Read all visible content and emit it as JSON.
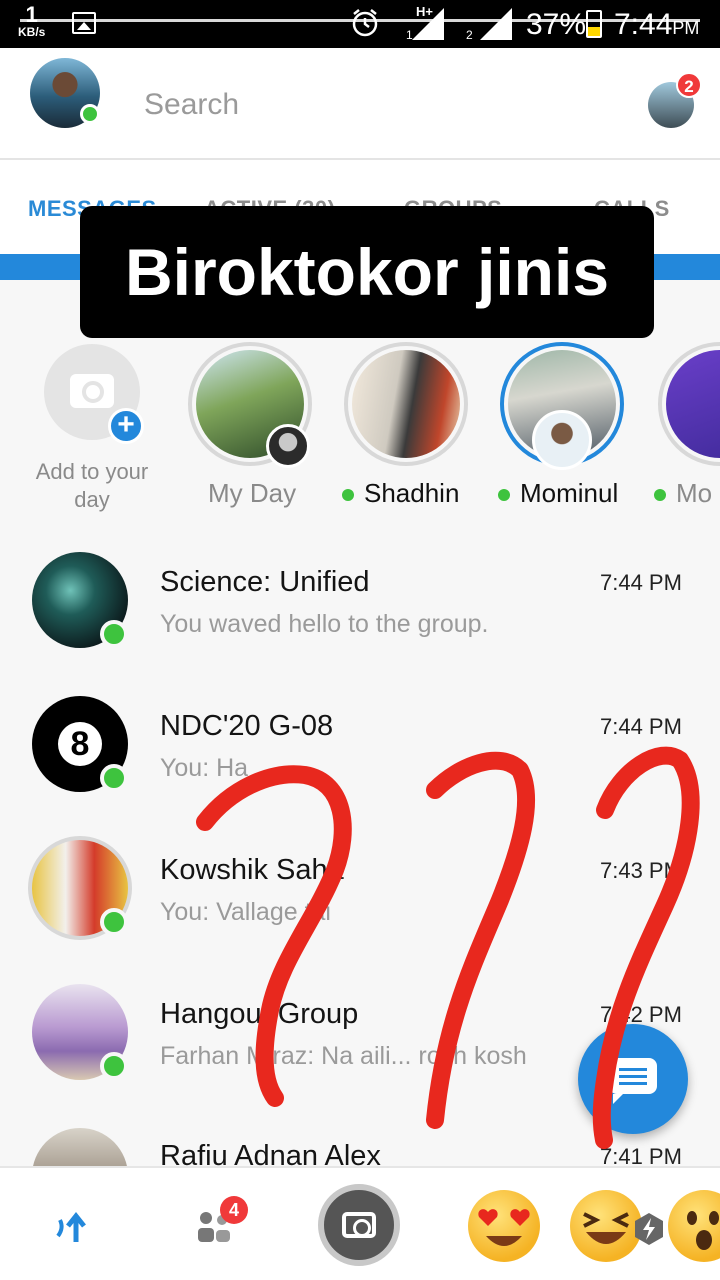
{
  "status_bar": {
    "net_speed": "1",
    "net_unit": "KB/s",
    "sim1": "1",
    "sim2": "2",
    "network_type": "H+",
    "battery": "37%",
    "time": "7:44",
    "time_suffix": "PM"
  },
  "header": {
    "search_placeholder": "Search",
    "people_badge": "2"
  },
  "tabs": [
    {
      "label": "MESSAGES",
      "active": true
    },
    {
      "label": "ACTIVE (30)",
      "active": false
    },
    {
      "label": "GROUPS",
      "active": false
    },
    {
      "label": "CALLS",
      "active": false
    }
  ],
  "overlay_caption": "Biroktokor jinis",
  "stories": {
    "add_label": "Add to your day",
    "items": [
      {
        "name": "My Day",
        "online": false
      },
      {
        "name": "Shadhin",
        "online": true
      },
      {
        "name": "Mominul",
        "online": true
      },
      {
        "name": "Mo",
        "online": true
      }
    ]
  },
  "conversations": [
    {
      "name": "Science: Unified",
      "snippet": "You waved hello to the group.",
      "time": "7:44 PM"
    },
    {
      "name": "NDC'20 G-08",
      "snippet": "You: Ha",
      "time": "7:44 PM"
    },
    {
      "name": "Kowshik Saha",
      "snippet": "You: Vallage tai",
      "time": "7:43 PM"
    },
    {
      "name": "Hangout Group",
      "snippet": "Farhan Miraz: Na aili... rosh kosh",
      "time": "7:42 PM"
    },
    {
      "name": "Rafiu Adnan Alex",
      "snippet": "",
      "time": "7:41 PM"
    }
  ],
  "bottom_bar": {
    "people_badge": "4"
  },
  "colors": {
    "accent": "#2388db",
    "online": "#3ec33e",
    "badge": "#f0393a",
    "scribble": "#e8281e"
  },
  "icons": [
    "home-icon",
    "people-icon",
    "camera-icon",
    "heart-eyes-emoji",
    "laughing-emoji",
    "surprised-emoji",
    "compose-message-icon"
  ]
}
